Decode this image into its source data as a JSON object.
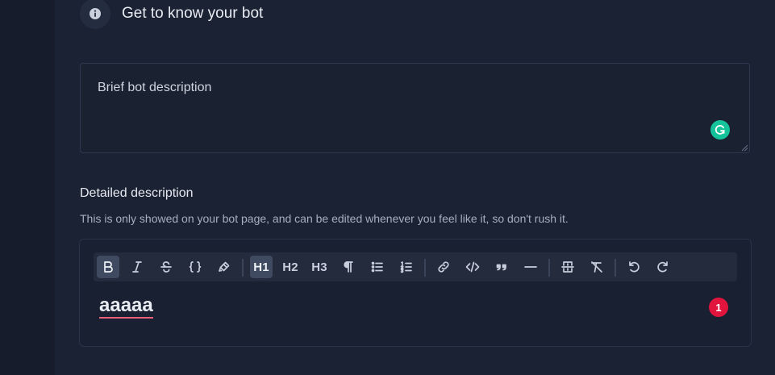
{
  "section": {
    "title": "Get to know your bot"
  },
  "brief": {
    "placeholder": "Brief bot description"
  },
  "detailed": {
    "label": "Detailed description",
    "hint": "This is only showed on your bot page, and can be edited whenever you feel like it, so don't rush it."
  },
  "toolbar": {
    "h1": "H1",
    "h2": "H2",
    "h3": "H3",
    "icons": [
      "bold-icon",
      "italic-icon",
      "strikethrough-icon",
      "code-icon",
      "highlight-icon",
      "heading-1",
      "heading-2",
      "heading-3",
      "paragraph-icon",
      "bullet-list-icon",
      "ordered-list-icon",
      "link-icon",
      "code-block-icon",
      "quote-icon",
      "horizontal-rule-icon",
      "clear-node-icon",
      "clear-format-icon",
      "undo-icon",
      "redo-icon"
    ]
  },
  "editor": {
    "content": "aaaaa",
    "error_count": "1"
  },
  "colors": {
    "background": "#1b2233",
    "accent_grammarly": "#15c39a",
    "error_badge": "#e0143c",
    "spell_underline": "#e8607a"
  }
}
